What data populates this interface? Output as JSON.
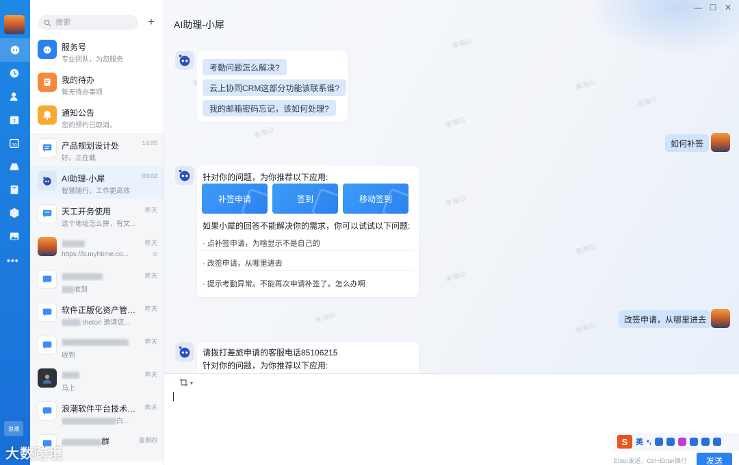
{
  "search": {
    "placeholder": "搜索"
  },
  "list": [
    {
      "name": "服务号",
      "sub": "专业团队，为您服务",
      "time": ""
    },
    {
      "name": "我的待办",
      "sub": "暂无待办事项",
      "time": ""
    },
    {
      "name": "通知公告",
      "sub": "您的预约已取消。",
      "time": ""
    },
    {
      "name": "产品规划设计处",
      "sub": "好。正在截",
      "time": "14:05"
    },
    {
      "name": "AI助理-小犀",
      "sub": "智慧随行，工作更高效",
      "time": "09:02"
    },
    {
      "name": "天工开务使用",
      "sub": "这个地址怎么拼，有文...",
      "time": "昨天"
    },
    {
      "name": "",
      "sub": "https://b.myhtime.co...",
      "time": "昨天"
    },
    {
      "name": "",
      "sub": "收到",
      "time": "昨天"
    },
    {
      "name": "软件正版化资产管理...",
      "sub": "thetorl 邀请您...",
      "time": "昨天"
    },
    {
      "name": "",
      "sub": "收到",
      "time": "昨天"
    },
    {
      "name": "",
      "sub": "马上",
      "time": "昨天"
    },
    {
      "name": "浪潮软件平台技术研...",
      "sub": "白...",
      "time": "昨天"
    },
    {
      "name": "群",
      "sub": "",
      "time": "星期四"
    }
  ],
  "chat": {
    "title": "AI助理-小犀",
    "suggestions": [
      "考勤问题怎么解决?",
      "云上协同CRM这部分功能该联系谁?",
      "我的邮箱密码忘记，该如何处理?"
    ],
    "my_msg_1": "如何补签",
    "reply1": {
      "intro": "针对你的问题，为你推荐以下应用:",
      "apps": [
        "补签申请",
        "签到",
        "移动签到"
      ],
      "followup": "如果小犀的回答不能解决你的需求，你可以试试以下问题:",
      "questions": [
        "· 点补签申请，为啥显示不是自己的",
        "· 改签申请，从哪里进去",
        "· 提示考勤异常。不能再次申请补签了。怎么办啊"
      ]
    },
    "my_msg_2": "改签申请，从哪里进去",
    "reply2": {
      "line1": "请拨打差旅申请的客服电话85106215",
      "line2": "针对你的问题，为你推荐以下应用:"
    },
    "watermark": "李海山"
  },
  "input": {
    "ime_lang": "英",
    "hint": "Enter发送，Ctrl+Enter换行",
    "send": "发送"
  },
  "rail": {
    "brand": "浪潮"
  },
  "logo_watermark": "大数跨境",
  "colors": {
    "accent": "#2b82ee",
    "rail": "#1e88e5"
  }
}
